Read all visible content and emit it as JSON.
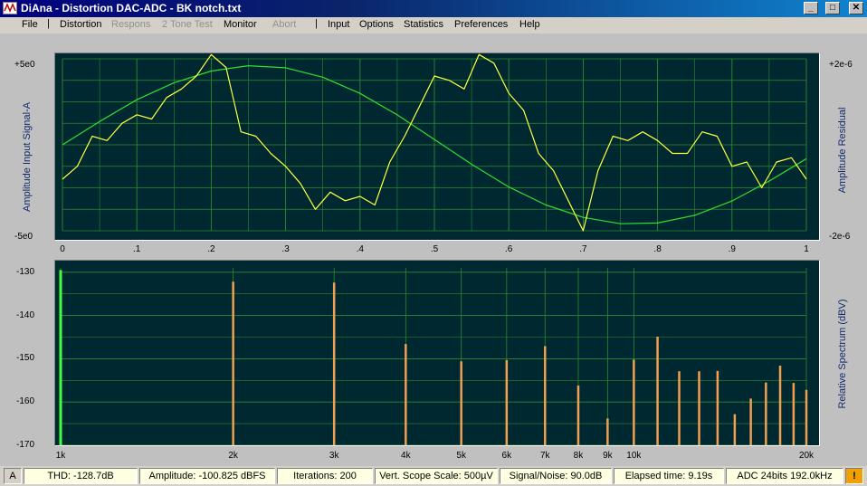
{
  "window": {
    "title": "DiAna - Distortion DAC-ADC - BK notch.txt",
    "minimize_icon": "minimize-icon",
    "maximize_icon": "maximize-icon",
    "close_icon": "close-icon",
    "minimize_glyph": "_",
    "maximize_glyph": "□",
    "close_glyph": "✕"
  },
  "menu": {
    "file": "File",
    "distortion": "Distortion",
    "respons": "Respons",
    "two_tone": "2 Tone Test",
    "monitor": "Monitor",
    "abort": "Abort",
    "separator": "|",
    "input": "Input",
    "options": "Options",
    "statistics": "Statistics",
    "preferences": "Preferences",
    "help": "Help"
  },
  "scope": {
    "left_top": "+5e0",
    "left_bottom": "-5e0",
    "right_top": "+2e-6",
    "right_bottom": "-2e-6",
    "left_axis_label": "Amplitude Input Signal-A",
    "right_axis_label": "Amplitude Residual",
    "x_ticks": [
      "0",
      ".1",
      ".2",
      ".3",
      ".4",
      ".5",
      ".6",
      ".7",
      ".8",
      ".9",
      "1"
    ],
    "signal_color": "#30e030",
    "residual_color": "#ffff40",
    "grid_color": "#2e8a2e"
  },
  "spectrum": {
    "y_ticks": [
      "-130",
      "-140",
      "-150",
      "-160",
      "-170"
    ],
    "x_ticks": [
      "1k",
      "2k",
      "3k",
      "4k",
      "5k",
      "6k",
      "7k",
      "8k",
      "9k",
      "10k",
      "20k"
    ],
    "right_axis_label": "Relative Spectrum (dBV)",
    "bar_color": "#f0a050",
    "fundamental_color": "#40ff40"
  },
  "chart_data": [
    {
      "type": "line",
      "title": "",
      "xlabel": "",
      "ylabel": "Amplitude Input Signal-A",
      "y2label": "Amplitude Residual",
      "xlim": [
        0,
        1
      ],
      "ylim": [
        -5,
        5
      ],
      "y2lim": [
        -2e-06,
        2e-06
      ],
      "grid": true,
      "series": [
        {
          "name": "",
          "axis": "left",
          "x": [
            0,
            0.05,
            0.1,
            0.15,
            0.2,
            0.25,
            0.3,
            0.35,
            0.4,
            0.45,
            0.5,
            0.55,
            0.6,
            0.65,
            0.7,
            0.75,
            0.8,
            0.85,
            0.9,
            0.95,
            1.0
          ],
          "values": [
            0,
            1.36,
            2.62,
            3.61,
            4.29,
            4.6,
            4.48,
            3.93,
            2.99,
            1.74,
            0.31,
            -1.13,
            -2.45,
            -3.5,
            -4.22,
            -4.59,
            -4.55,
            -4.1,
            -3.27,
            -2.11,
            -0.81
          ]
        },
        {
          "name": "",
          "axis": "right",
          "x": [
            0,
            0.02,
            0.04,
            0.06,
            0.08,
            0.1,
            0.12,
            0.14,
            0.16,
            0.18,
            0.2,
            0.22,
            0.24,
            0.26,
            0.28,
            0.3,
            0.32,
            0.34,
            0.36,
            0.38,
            0.4,
            0.42,
            0.44,
            0.46,
            0.48,
            0.5,
            0.52,
            0.54,
            0.56,
            0.58,
            0.6,
            0.62,
            0.64,
            0.66,
            0.68,
            0.7,
            0.72,
            0.74,
            0.76,
            0.78,
            0.8,
            0.82,
            0.84,
            0.86,
            0.88,
            0.9,
            0.92,
            0.94,
            0.96,
            0.98,
            1.0
          ],
          "values": [
            -8e-07,
            -5e-07,
            2e-07,
            1e-07,
            5e-07,
            7e-07,
            6e-07,
            1.1e-06,
            1.3e-06,
            1.6e-06,
            2.1e-06,
            1.8e-06,
            3e-07,
            2e-07,
            -2e-07,
            -5e-07,
            -9e-07,
            -1.5e-06,
            -1.1e-06,
            -1.3e-06,
            -1.2e-06,
            -1.4e-06,
            -4e-07,
            2e-07,
            9e-07,
            1.6e-06,
            1.5e-06,
            1.3e-06,
            2.1e-06,
            1.9e-06,
            1.2e-06,
            8e-07,
            -2e-07,
            -6e-07,
            -1.3e-06,
            -2e-06,
            -6e-07,
            2e-07,
            1e-07,
            3e-07,
            1e-07,
            -2e-07,
            -2e-07,
            3e-07,
            2e-07,
            -5e-07,
            -4e-07,
            -1e-06,
            -4e-07,
            -3e-07,
            -8e-07
          ]
        }
      ]
    },
    {
      "type": "bar",
      "title": "",
      "ylabel": "Relative Spectrum (dBV)",
      "xscale": "log",
      "xlim": [
        1000,
        20000
      ],
      "ylim": [
        -170,
        -129
      ],
      "grid": true,
      "x": [
        1000,
        2000,
        3000,
        4000,
        5000,
        6000,
        7000,
        8000,
        9000,
        10000,
        11000,
        12000,
        13000,
        14000,
        15000,
        16000,
        17000,
        18000,
        19000,
        20000
      ],
      "values": [
        -129.5,
        -132.2,
        -132.4,
        -146.6,
        -150.6,
        -150.3,
        -147.1,
        -156.2,
        -163.8,
        -150.2,
        -144.9,
        -152.9,
        -152.9,
        -152.8,
        -162.8,
        -159.2,
        -155.5,
        -151.6,
        -155.6,
        -157.2
      ]
    }
  ],
  "status": {
    "mode": "A",
    "thd": "THD: -128.7dB",
    "amplitude": "Amplitude: -100.825 dBFS",
    "iterations": "Iterations: 200",
    "scope_scale": "Vert. Scope Scale: 500µV",
    "snr": "Signal/Noise:   90.0dB",
    "elapsed": "Elapsed time: 9.19s",
    "adc": "ADC 24bits 192.0kHz",
    "warning": "!"
  }
}
